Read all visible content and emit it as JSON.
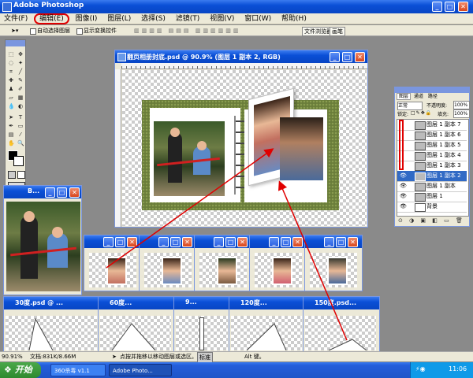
{
  "app": {
    "title": "Adobe Photoshop"
  },
  "menu": [
    {
      "label": "文件(F)"
    },
    {
      "label": "编辑(E)"
    },
    {
      "label": "图像(I)"
    },
    {
      "label": "图层(L)"
    },
    {
      "label": "选择(S)"
    },
    {
      "label": "滤镜(T)"
    },
    {
      "label": "视图(V)"
    },
    {
      "label": "窗口(W)"
    },
    {
      "label": "帮助(H)"
    }
  ],
  "options_bar": {
    "auto_select_label": "自动选择图层",
    "show_bounds_label": "显示变换控件",
    "tabs": [
      "文件浏览器",
      "画笔"
    ]
  },
  "main_doc": {
    "title": "翻页相册封底.psd @ 90.9% (图层 1 副本 2, RGB)"
  },
  "layers_panel": {
    "tabs": [
      "图层",
      "通道",
      "路径"
    ],
    "blend_mode": "正常",
    "opacity_label": "不透明度:",
    "opacity": "100%",
    "lock_label": "锁定:",
    "fill_label": "填充:",
    "fill": "100%",
    "layers": [
      {
        "name": "图层 1 副本 7",
        "selected": false
      },
      {
        "name": "图层 1 副本 6",
        "selected": false
      },
      {
        "name": "图层 1 副本 5",
        "selected": false
      },
      {
        "name": "图层 1 副本 4",
        "selected": false
      },
      {
        "name": "图层 1 副本 3",
        "selected": false
      },
      {
        "name": "图层 1 副本 2",
        "selected": true
      },
      {
        "name": "图层 1 副本",
        "selected": false
      },
      {
        "name": "图层 1",
        "selected": false
      },
      {
        "name": "背景",
        "selected": false
      }
    ]
  },
  "source_window": {
    "title": "B..."
  },
  "bottom_windows": [
    {
      "title": "30度.psd @ ..."
    },
    {
      "title": "60度..."
    },
    {
      "title": "9..."
    },
    {
      "title": "120度..."
    },
    {
      "title": "150度.psd..."
    }
  ],
  "status": {
    "zoom": "90.91%",
    "doc_size": "文档:831K/8.66M",
    "hint": "点按并拖移以移动图层或选区。要用",
    "zoom_btn_label": "标准",
    "alt_hint": "Alt 键。"
  },
  "taskbar": {
    "start_label": "开始",
    "items": [
      "360杀毒 v1.1",
      "Adobe Photo..."
    ],
    "clock": "11:06"
  },
  "colors": {
    "xp_blue": "#0a4fd6",
    "highlight_red": "#e00000",
    "selected_layer": "#316ac5"
  }
}
